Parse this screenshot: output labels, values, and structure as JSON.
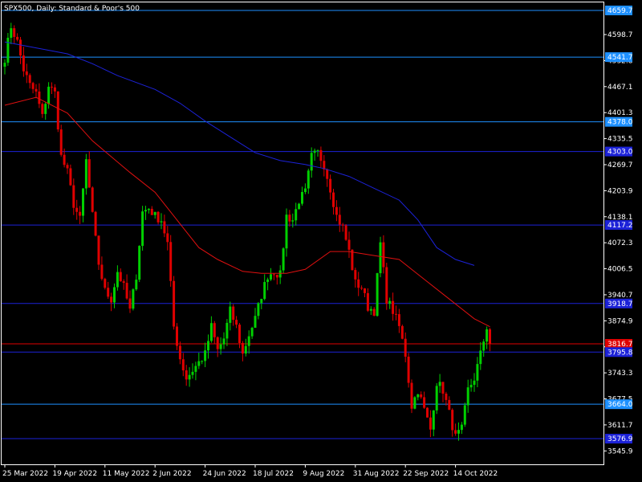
{
  "header": {
    "title": "SPX500, Daily:  Standard & Poor's 500"
  },
  "colors": {
    "background": "#000000",
    "frame": "#ffffff",
    "bull": "#00d000",
    "bear": "#e00000",
    "ma_fast": "#e01010",
    "ma_slow": "#1c22d8",
    "level_light": "#1e90ff",
    "level_dark": "#1c22d8",
    "level_current": "#e00000"
  },
  "chart_data": {
    "type": "candlestick",
    "title": "SPX500, Daily:  Standard & Poor's 500",
    "ylim": [
      3512.0,
      4680.0
    ],
    "y_ticks": [
      "4598.7",
      "4532.8",
      "4467.1",
      "4401.3",
      "4335.5",
      "4269.7",
      "4203.9",
      "4138.1",
      "4072.3",
      "4006.5",
      "3940.7",
      "3874.9",
      "3809.1",
      "3743.3",
      "3677.5",
      "3611.7",
      "3545.9"
    ],
    "x_ticks": [
      {
        "index": 0,
        "label": "25 Mar 2022"
      },
      {
        "index": 16,
        "label": "19 Apr 2022"
      },
      {
        "index": 32,
        "label": "11 May 2022"
      },
      {
        "index": 48,
        "label": "2 Jun 2022"
      },
      {
        "index": 64,
        "label": "24 Jun 2022"
      },
      {
        "index": 80,
        "label": "18 Jul 2022"
      },
      {
        "index": 96,
        "label": "9 Aug 2022"
      },
      {
        "index": 112,
        "label": "31 Aug 2022"
      },
      {
        "index": 128,
        "label": "22 Sep 2022"
      },
      {
        "index": 144,
        "label": "14 Oct 2022"
      }
    ],
    "horizontal_levels": [
      {
        "value": 4659.7,
        "label": "4659.7",
        "style": "light"
      },
      {
        "value": 4541.7,
        "label": "4541.7",
        "style": "light"
      },
      {
        "value": 4378.0,
        "label": "4378.0",
        "style": "light"
      },
      {
        "value": 4303.0,
        "label": "4303.0",
        "style": "dark"
      },
      {
        "value": 4117.2,
        "label": "4117.2",
        "style": "dark"
      },
      {
        "value": 3918.7,
        "label": "3918.7",
        "style": "dark"
      },
      {
        "value": 3816.7,
        "label": "3816.7",
        "style": "current"
      },
      {
        "value": 3795.8,
        "label": "3795.8",
        "style": "dark"
      },
      {
        "value": 3664.0,
        "label": "3664.0",
        "style": "light"
      },
      {
        "value": 3576.9,
        "label": "3576.9",
        "style": "dark"
      }
    ],
    "anchors": [
      [
        0,
        4540
      ],
      [
        2,
        4620
      ],
      [
        4,
        4580
      ],
      [
        6,
        4510
      ],
      [
        8,
        4470
      ],
      [
        10,
        4450
      ],
      [
        12,
        4390
      ],
      [
        14,
        4470
      ],
      [
        16,
        4450
      ],
      [
        18,
        4290
      ],
      [
        20,
        4250
      ],
      [
        22,
        4170
      ],
      [
        24,
        4130
      ],
      [
        26,
        4280
      ],
      [
        28,
        4140
      ],
      [
        30,
        4020
      ],
      [
        32,
        3950
      ],
      [
        34,
        3930
      ],
      [
        36,
        4000
      ],
      [
        38,
        3960
      ],
      [
        40,
        3900
      ],
      [
        42,
        3990
      ],
      [
        44,
        4150
      ],
      [
        46,
        4160
      ],
      [
        48,
        4140
      ],
      [
        50,
        4130
      ],
      [
        52,
        4070
      ],
      [
        54,
        3860
      ],
      [
        56,
        3780
      ],
      [
        58,
        3730
      ],
      [
        60,
        3750
      ],
      [
        62,
        3770
      ],
      [
        64,
        3790
      ],
      [
        66,
        3860
      ],
      [
        68,
        3800
      ],
      [
        70,
        3830
      ],
      [
        72,
        3900
      ],
      [
        74,
        3860
      ],
      [
        76,
        3790
      ],
      [
        78,
        3840
      ],
      [
        80,
        3880
      ],
      [
        82,
        3940
      ],
      [
        84,
        3990
      ],
      [
        86,
        4000
      ],
      [
        88,
        3990
      ],
      [
        90,
        4140
      ],
      [
        92,
        4130
      ],
      [
        94,
        4180
      ],
      [
        96,
        4200
      ],
      [
        98,
        4290
      ],
      [
        100,
        4300
      ],
      [
        102,
        4270
      ],
      [
        104,
        4210
      ],
      [
        106,
        4140
      ],
      [
        108,
        4110
      ],
      [
        110,
        4050
      ],
      [
        112,
        3970
      ],
      [
        114,
        3960
      ],
      [
        116,
        3910
      ],
      [
        118,
        3900
      ],
      [
        120,
        4070
      ],
      [
        122,
        3930
      ],
      [
        124,
        3900
      ],
      [
        126,
        3860
      ],
      [
        128,
        3790
      ],
      [
        130,
        3660
      ],
      [
        132,
        3700
      ],
      [
        134,
        3650
      ],
      [
        136,
        3600
      ],
      [
        138,
        3720
      ],
      [
        140,
        3700
      ],
      [
        142,
        3640
      ],
      [
        144,
        3580
      ],
      [
        146,
        3600
      ],
      [
        148,
        3700
      ],
      [
        150,
        3730
      ],
      [
        152,
        3790
      ],
      [
        154,
        3860
      ],
      [
        155,
        3816.7
      ]
    ],
    "series": [
      {
        "name": "",
        "type": "ma",
        "role": "fast",
        "points": [
          [
            0,
            4420
          ],
          [
            10,
            4440
          ],
          [
            20,
            4400
          ],
          [
            28,
            4330
          ],
          [
            40,
            4250
          ],
          [
            48,
            4200
          ],
          [
            56,
            4120
          ],
          [
            62,
            4060
          ],
          [
            68,
            4030
          ],
          [
            76,
            4000
          ],
          [
            82,
            3995
          ],
          [
            90,
            3995
          ],
          [
            96,
            4005
          ],
          [
            104,
            4050
          ],
          [
            110,
            4050
          ],
          [
            118,
            4040
          ],
          [
            126,
            4030
          ],
          [
            134,
            3980
          ],
          [
            142,
            3930
          ],
          [
            150,
            3880
          ],
          [
            155,
            3860
          ]
        ]
      },
      {
        "name": "",
        "type": "ma",
        "role": "slow",
        "points": [
          [
            0,
            4580
          ],
          [
            10,
            4565
          ],
          [
            20,
            4550
          ],
          [
            28,
            4525
          ],
          [
            36,
            4495
          ],
          [
            48,
            4460
          ],
          [
            56,
            4425
          ],
          [
            64,
            4380
          ],
          [
            72,
            4340
          ],
          [
            80,
            4300
          ],
          [
            88,
            4280
          ],
          [
            96,
            4270
          ],
          [
            102,
            4260
          ],
          [
            110,
            4240
          ],
          [
            118,
            4210
          ],
          [
            126,
            4180
          ],
          [
            132,
            4130
          ],
          [
            138,
            4060
          ],
          [
            144,
            4030
          ],
          [
            150,
            4015
          ]
        ]
      }
    ],
    "candle_count": 156
  }
}
